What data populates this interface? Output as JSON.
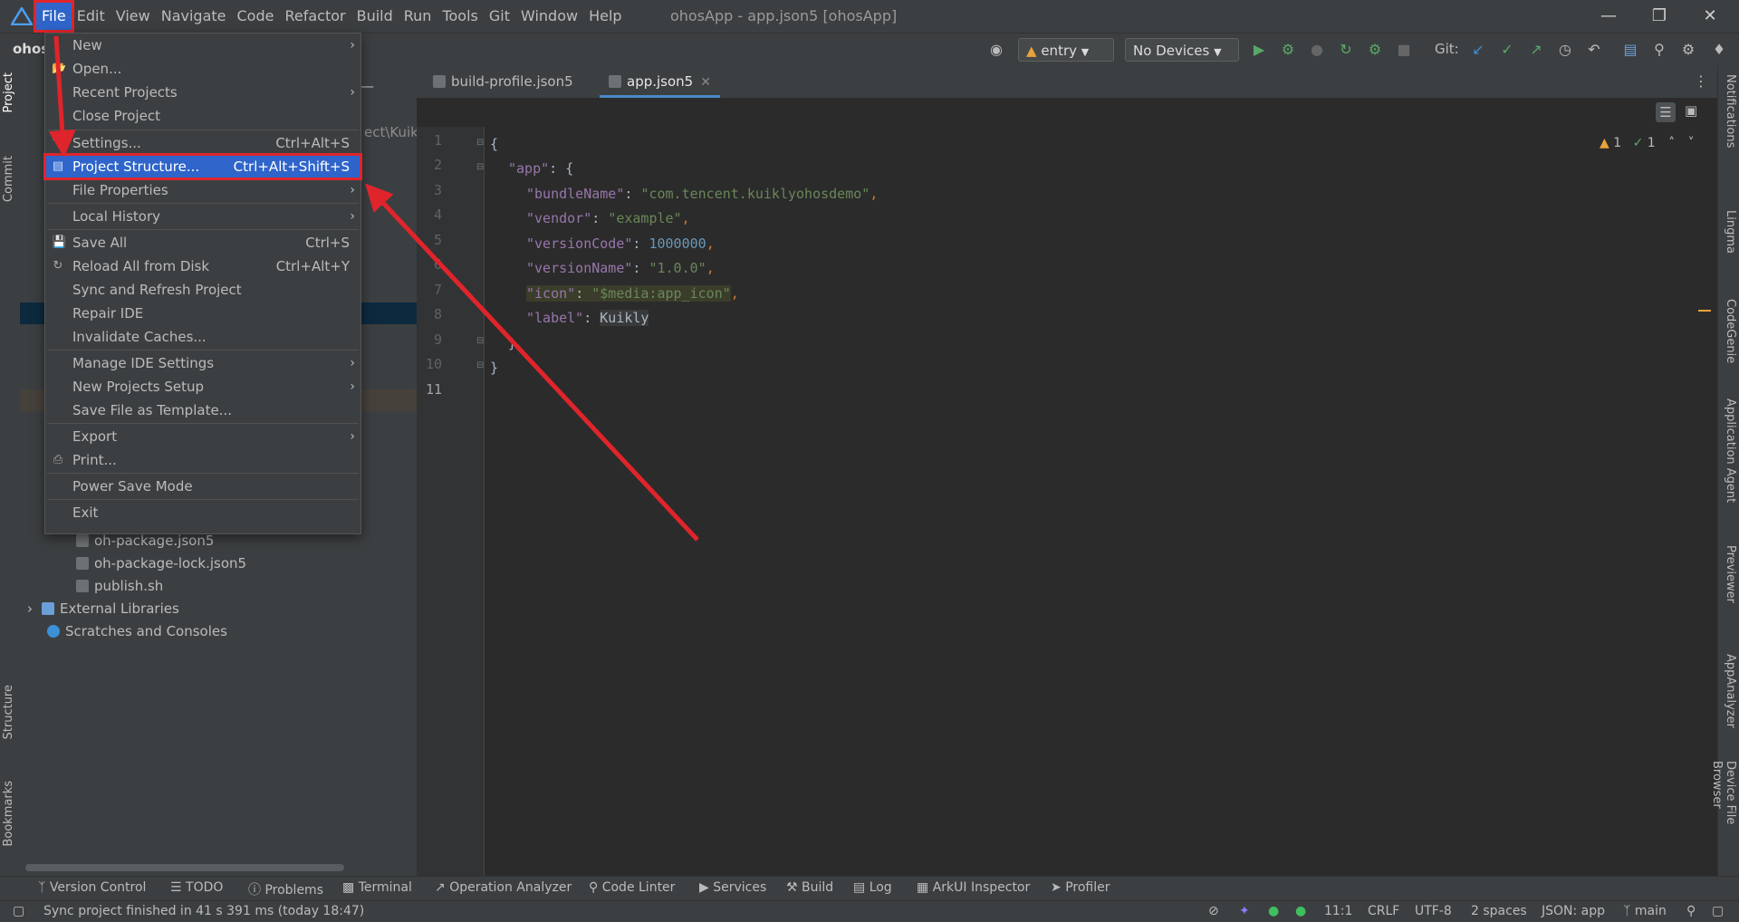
{
  "menubar": [
    "File",
    "Edit",
    "View",
    "Navigate",
    "Code",
    "Refactor",
    "Build",
    "Run",
    "Tools",
    "Git",
    "Window",
    "Help"
  ],
  "window_title": "ohosApp - app.json5 [ohosApp]",
  "toolbar": {
    "project_name": "ohos",
    "run_config": "entry",
    "devices": "No Devices",
    "git_label": "Git:"
  },
  "file_menu": [
    {
      "label": "New",
      "shortcut": "",
      "submenu": true,
      "icon": ""
    },
    {
      "label": "Open...",
      "shortcut": "",
      "submenu": false,
      "icon": "folder-open-icon"
    },
    {
      "label": "Recent Projects",
      "shortcut": "",
      "submenu": true,
      "icon": ""
    },
    {
      "label": "Close Project",
      "shortcut": "",
      "submenu": false,
      "icon": ""
    },
    {
      "label": "Settings...",
      "shortcut": "Ctrl+Alt+S",
      "submenu": false,
      "icon": "wrench-icon"
    },
    {
      "label": "Project Structure...",
      "shortcut": "Ctrl+Alt+Shift+S",
      "submenu": false,
      "icon": "project-structure-icon",
      "selected": true
    },
    {
      "label": "File Properties",
      "shortcut": "",
      "submenu": true,
      "icon": ""
    },
    {
      "label": "Local History",
      "shortcut": "",
      "submenu": true,
      "icon": ""
    },
    {
      "label": "Save All",
      "shortcut": "Ctrl+S",
      "submenu": false,
      "icon": "save-icon"
    },
    {
      "label": "Reload All from Disk",
      "shortcut": "Ctrl+Alt+Y",
      "submenu": false,
      "icon": "reload-icon"
    },
    {
      "label": "Sync and Refresh Project",
      "shortcut": "",
      "submenu": false,
      "icon": ""
    },
    {
      "label": "Repair IDE",
      "shortcut": "",
      "submenu": false,
      "icon": ""
    },
    {
      "label": "Invalidate Caches...",
      "shortcut": "",
      "submenu": false,
      "icon": ""
    },
    {
      "label": "Manage IDE Settings",
      "shortcut": "",
      "submenu": true,
      "icon": ""
    },
    {
      "label": "New Projects Setup",
      "shortcut": "",
      "submenu": true,
      "icon": ""
    },
    {
      "label": "Save File as Template...",
      "shortcut": "",
      "submenu": false,
      "icon": ""
    },
    {
      "label": "Export",
      "shortcut": "",
      "submenu": true,
      "icon": ""
    },
    {
      "label": "Print...",
      "shortcut": "",
      "submenu": false,
      "icon": "printer-icon"
    },
    {
      "label": "Power Save Mode",
      "shortcut": "",
      "submenu": false,
      "icon": ""
    },
    {
      "label": "Exit",
      "shortcut": "",
      "submenu": false,
      "icon": ""
    }
  ],
  "project_tree": {
    "path_fragment": "ect\\Kuikly",
    "items": [
      "oh-package.json5",
      "oh-package-lock.json5",
      "publish.sh",
      "External Libraries",
      "Scratches and Consoles"
    ]
  },
  "tabs": [
    {
      "label": "build-profile.json5",
      "active": false
    },
    {
      "label": "app.json5",
      "active": true
    }
  ],
  "inspection": {
    "warnings": "1",
    "ok": "1"
  },
  "code_lines": [
    "1",
    "2",
    "3",
    "4",
    "5",
    "6",
    "7",
    "8",
    "9",
    "10",
    "11"
  ],
  "code": {
    "l1": "{",
    "l2_key": "\"app\"",
    "l2_rest": ": {",
    "l3_key": "\"bundleName\"",
    "l3_val": "\"com.tencent.kuiklyohosdemo\"",
    "l4_key": "\"vendor\"",
    "l4_val": "\"example\"",
    "l5_key": "\"versionCode\"",
    "l5_val": "1000000",
    "l6_key": "\"versionName\"",
    "l6_val": "\"1.0.0\"",
    "l7_key": "\"icon\"",
    "l7_val": "\"$media:app_icon\"",
    "l8_key": "\"label\"",
    "l8_val": "Kuikly",
    "l9": "}",
    "l10": "}"
  },
  "left_stripe": [
    "Project",
    "Commit",
    "Structure",
    "Bookmarks"
  ],
  "right_stripe": [
    "Notifications",
    "Lingma",
    "CodeGenie",
    "Application Agent",
    "Previewer",
    "AppAnalyzer",
    "Device File Browser"
  ],
  "tool_tabs": [
    "Version Control",
    "TODO",
    "Problems",
    "Terminal",
    "Operation Analyzer",
    "Code Linter",
    "Services",
    "Build",
    "Log",
    "ArkUI Inspector",
    "Profiler"
  ],
  "status": {
    "message": "Sync project finished in 41 s 391 ms (today 18:47)",
    "position": "11:1",
    "line_sep": "CRLF",
    "encoding": "UTF-8",
    "indent": "2 spaces",
    "schema": "JSON: app",
    "branch": "main"
  },
  "colors": {
    "accent": "#2f65ca",
    "annotation": "#e0242b"
  }
}
